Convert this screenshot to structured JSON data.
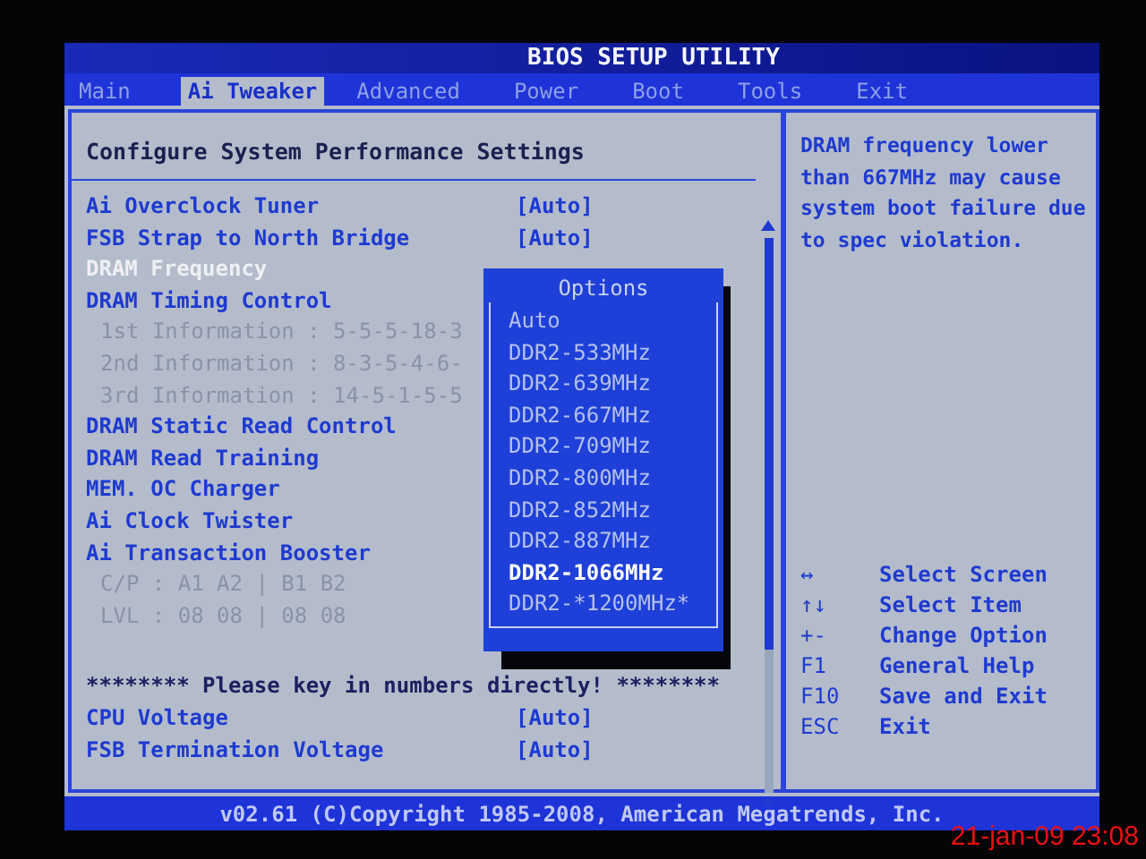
{
  "title": "BIOS SETUP UTILITY",
  "tabs": [
    {
      "label": "Main",
      "selected": false
    },
    {
      "label": "Ai Tweaker",
      "selected": true
    },
    {
      "label": "Advanced",
      "selected": false
    },
    {
      "label": "Power",
      "selected": false
    },
    {
      "label": "Boot",
      "selected": false
    },
    {
      "label": "Tools",
      "selected": false
    },
    {
      "label": "Exit",
      "selected": false
    }
  ],
  "section_title": "Configure System Performance Settings",
  "settings": [
    {
      "kind": "item",
      "label": "Ai Overclock Tuner",
      "value": "[Auto]"
    },
    {
      "kind": "item",
      "label": "FSB Strap to North Bridge",
      "value": "[Auto]"
    },
    {
      "kind": "current",
      "label": "DRAM Frequency"
    },
    {
      "kind": "item",
      "label": "DRAM Timing Control"
    },
    {
      "kind": "info",
      "label": "1st Information : 5-5-5-18-3"
    },
    {
      "kind": "info",
      "label": "2nd Information : 8-3-5-4-6-"
    },
    {
      "kind": "info",
      "label": "3rd Information : 14-5-1-5-5"
    },
    {
      "kind": "item",
      "label": "DRAM Static Read Control"
    },
    {
      "kind": "item",
      "label": "DRAM Read Training"
    },
    {
      "kind": "item",
      "label": "MEM. OC Charger"
    },
    {
      "kind": "item",
      "label": "Ai Clock Twister"
    },
    {
      "kind": "item",
      "label": "Ai Transaction Booster"
    },
    {
      "kind": "info",
      "label": "C/P : A1 A2 | B1 B2"
    },
    {
      "kind": "info",
      "label": "LVL : 08 08 | 08 08"
    },
    {
      "kind": "note",
      "label": "******** Please key in numbers directly! ********"
    },
    {
      "kind": "item",
      "label": "CPU Voltage",
      "value": "[Auto]"
    },
    {
      "kind": "item",
      "label": "FSB Termination Voltage",
      "value": "[Auto]"
    }
  ],
  "options": {
    "title": "Options",
    "items": [
      {
        "label": "Auto",
        "selected": false
      },
      {
        "label": "DDR2-533MHz",
        "selected": false
      },
      {
        "label": "DDR2-639MHz",
        "selected": false
      },
      {
        "label": "DDR2-667MHz",
        "selected": false
      },
      {
        "label": "DDR2-709MHz",
        "selected": false
      },
      {
        "label": "DDR2-800MHz",
        "selected": false
      },
      {
        "label": "DDR2-852MHz",
        "selected": false
      },
      {
        "label": "DDR2-887MHz",
        "selected": false
      },
      {
        "label": "DDR2-1066MHz",
        "selected": true
      },
      {
        "label": "DDR2-*1200MHz*",
        "selected": false
      }
    ]
  },
  "help": "DRAM frequency lower than 667MHz may cause system boot failure due to spec violation.",
  "keys": [
    {
      "key": "↔",
      "action": "Select Screen"
    },
    {
      "key": "↑↓",
      "action": "Select Item"
    },
    {
      "key": "+-",
      "action": "Change Option"
    },
    {
      "key": "F1",
      "action": "General Help"
    },
    {
      "key": "F10",
      "action": "Save and Exit"
    },
    {
      "key": "ESC",
      "action": "Exit"
    }
  ],
  "footer": "v02.61 (C)Copyright 1985-2008, American Megatrends, Inc.",
  "timestamp": "21-jan-09 23:08"
}
